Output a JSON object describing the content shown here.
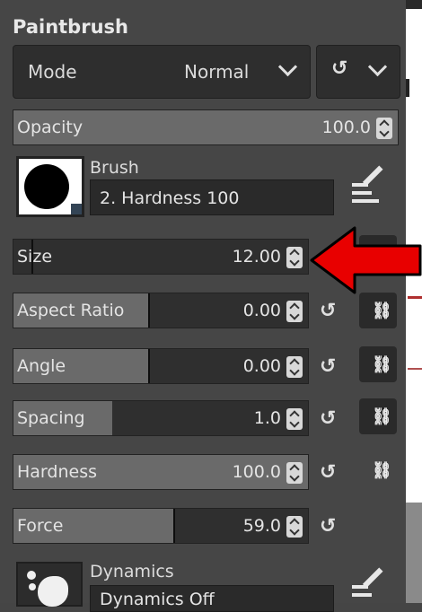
{
  "panel": {
    "title": "Paintbrush",
    "mode": {
      "label": "Mode",
      "value": "Normal"
    },
    "opacity": {
      "label": "Opacity",
      "value": "100.0"
    },
    "brush": {
      "label": "Brush",
      "name": "2. Hardness 100"
    },
    "sliders": [
      {
        "key": "size",
        "label": "Size",
        "value": "12.00"
      },
      {
        "key": "aspect-ratio",
        "label": "Aspect Ratio",
        "value": "0.00"
      },
      {
        "key": "angle",
        "label": "Angle",
        "value": "0.00"
      },
      {
        "key": "spacing",
        "label": "Spacing",
        "value": "1.0"
      },
      {
        "key": "hardness",
        "label": "Hardness",
        "value": "100.0"
      },
      {
        "key": "force",
        "label": "Force",
        "value": "59.0"
      }
    ],
    "dynamics": {
      "label": "Dynamics",
      "name": "Dynamics Off"
    }
  },
  "colors": {
    "panel_bg": "#464646",
    "field_bg": "#2f2f2f",
    "fill": "#6a6a6a",
    "text": "#e4e4e4",
    "arrow": "#e80000"
  },
  "icons": [
    "reset-icon",
    "chevron-down-icon",
    "edit-icon",
    "chain-link-icon",
    "spin-arrows-icon"
  ]
}
